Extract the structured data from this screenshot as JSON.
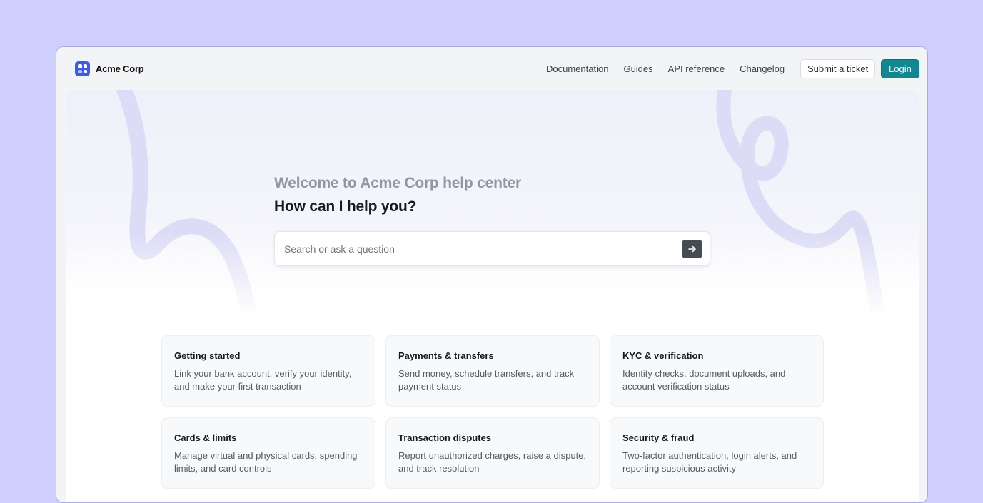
{
  "brand": {
    "name": "Acme Corp",
    "logo_color": "#3b5bf0"
  },
  "nav": {
    "links": [
      "Documentation",
      "Guides",
      "API reference",
      "Changelog"
    ],
    "submit_ticket": "Submit a ticket",
    "login": "Login",
    "accent": "#0f8891"
  },
  "hero": {
    "subtitle": "Welcome to Acme Corp help center",
    "title": "How can I help you?",
    "search_placeholder": "Search or ask a question",
    "search_icon": "arrow-right-icon"
  },
  "categories": [
    {
      "title": "Getting started",
      "description": "Link your bank account, verify your identity, and make your first transaction"
    },
    {
      "title": "Payments & transfers",
      "description": "Send money, schedule transfers, and track payment status"
    },
    {
      "title": "KYC & verification",
      "description": "Identity checks, document uploads, and account verification status"
    },
    {
      "title": "Cards & limits",
      "description": "Manage virtual and physical cards, spending limits, and card controls"
    },
    {
      "title": "Transaction disputes",
      "description": "Report unauthorized charges, raise a dispute, and track resolution"
    },
    {
      "title": "Security & fraud",
      "description": "Two-factor authentication, login alerts, and reporting suspicious activity"
    }
  ]
}
